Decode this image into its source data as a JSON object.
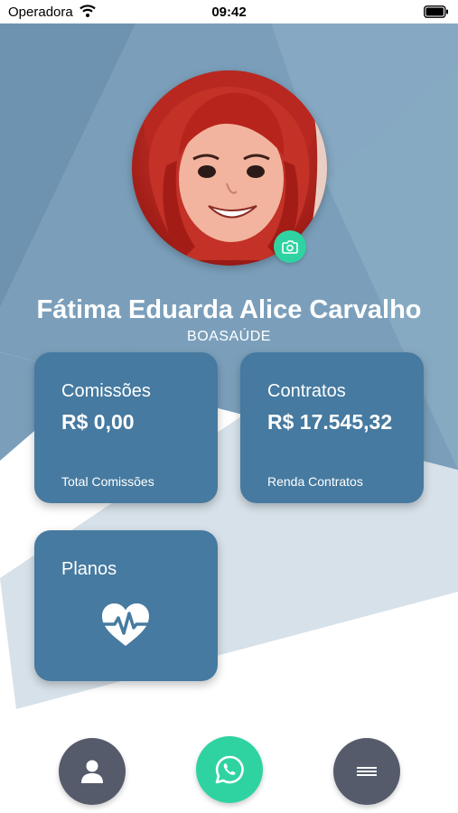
{
  "status_bar": {
    "carrier": "Operadora",
    "time": "09:42"
  },
  "profile": {
    "name": "Fátima Eduarda Alice Carvalho",
    "company": "BOASAÚDE"
  },
  "cards": {
    "commissions": {
      "title": "Comissões",
      "value": "R$ 0,00",
      "caption": "Total Comissões"
    },
    "contracts": {
      "title": "Contratos",
      "value": "R$ 17.545,32",
      "caption": "Renda Contratos"
    },
    "plans": {
      "title": "Planos",
      "icon": "heart-pulse-icon"
    }
  },
  "bottom_nav": {
    "profile_icon": "person-icon",
    "whatsapp_icon": "whatsapp-icon",
    "menu_icon": "menu-icon"
  },
  "colors": {
    "card": "#467aa0",
    "accent_green": "#2fd3a1",
    "nav_gray": "#555b6b",
    "background_blue": "#7b9fbb"
  }
}
